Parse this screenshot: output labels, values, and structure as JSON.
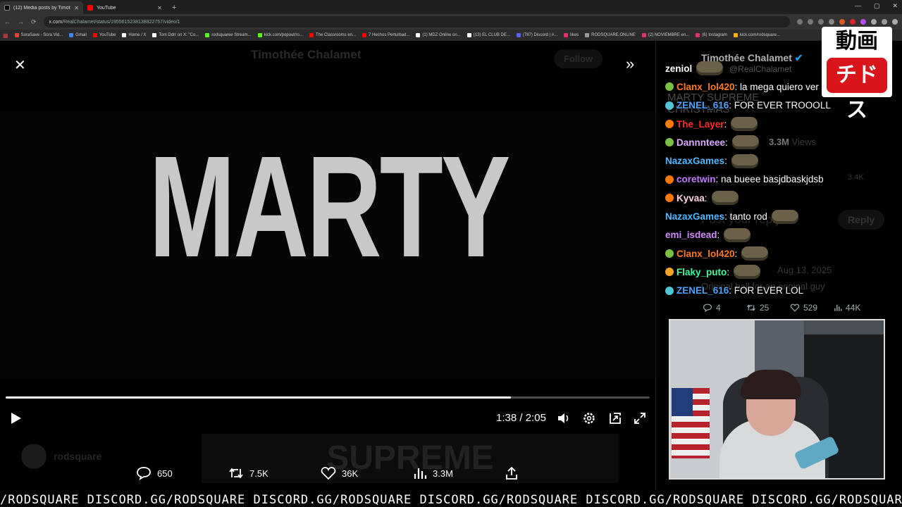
{
  "browser": {
    "tabs": [
      {
        "title": "(12) Media posts by Timoth",
        "active": true,
        "icon": "x-icon"
      },
      {
        "title": "YouTube",
        "active": false,
        "icon": "youtube-icon"
      }
    ],
    "new_tab": "+",
    "url_prefix": "x.com",
    "url_path": "/RealChalamet/status/1955615238138822757/video/1",
    "bookmarks": [
      "SoraSave - Sora Vid...",
      "Gmail",
      "YouTube",
      "Home / X",
      "Tom Ddrr on X: \"Co...",
      "rodsquaree Stream...",
      "kick.com/popout/ro...",
      "The Classrooms en...",
      "7 Hechos Perturbad...",
      "(1) MDZ Online on...",
      "(13) EL CLUB DE...",
      "(787) Discord | #...",
      "likes",
      "RODSQUARE.ONLINE",
      "(2) NOVIEMBRE en...",
      "(6) Instagram",
      "kick.com/rodsquare..."
    ]
  },
  "video": {
    "title_text": "MARTY",
    "current_time": "1:38",
    "duration": "2:05",
    "time_separator": " / ",
    "progress_fraction": 0.784,
    "ghost_header": "Timothée Chalamet",
    "ghost_follow": "Follow",
    "ghost_user": "rodsquare",
    "ghost_thumb": "SUPREME"
  },
  "actions": {
    "replies": "650",
    "reposts": "7.5K",
    "likes": "36K",
    "views": "3.3M"
  },
  "tweet_panel": {
    "author": "Timothée Chalamet",
    "handle": "@RealChalamet",
    "text_line1": "MARTY SUPREME",
    "text_line2": "CHRISTMAS",
    "views": "3.3M",
    "views_label": "Views",
    "count_small": "3.4K",
    "post_placeholder": "Post your reply",
    "reply_button": "Reply",
    "reply_date": "Aug 13, 2025",
    "reply_text": "Original ball for an original guy",
    "stats": {
      "replies": "4",
      "reposts": "25",
      "likes": "529",
      "views": "44K"
    }
  },
  "chat": [
    {
      "user": "zeniol",
      "color": "#ffffff",
      "badge": "",
      "text": "",
      "emote": true
    },
    {
      "user": "Clanx_lol420",
      "color": "#ff7a1a",
      "badge": "#7ac143",
      "text": ": la mega quiero ver",
      "emote": false
    },
    {
      "user": "ZENEL_616",
      "color": "#4fa3ff",
      "badge": "#52c4d6",
      "text": ": FOR EVER TROOOLL",
      "emote": false
    },
    {
      "user": "The_Layer",
      "color": "#ff2b2b",
      "badge": "#ff7a00",
      "text": ":",
      "emote": true
    },
    {
      "user": "Dannnteee",
      "color": "#d8a8ff",
      "badge": "#7ac143",
      "text": ":",
      "emote": true
    },
    {
      "user": "NazaxGames",
      "color": "#4fb8ff",
      "badge": "",
      "text": ":",
      "emote": true
    },
    {
      "user": "coretwin",
      "color": "#c07bff",
      "badge": "#ff7a00",
      "text": ": na bueee basjdbaskjdsb",
      "emote": false
    },
    {
      "user": "Kyvaa",
      "color": "#ffd0e6",
      "badge": "#ff7a00",
      "text": ":",
      "emote": true
    },
    {
      "user": "NazaxGames",
      "color": "#4fb8ff",
      "badge": "",
      "text": ": tanto rod",
      "emote": true
    },
    {
      "user": "emi_isdead",
      "color": "#d08cff",
      "badge": "",
      "text": ":",
      "emote": true
    },
    {
      "user": "Clanx_lol420",
      "color": "#ff7a1a",
      "badge": "#7ac143",
      "text": ":",
      "emote": true
    },
    {
      "user": "Flaky_puto",
      "color": "#3cff9a",
      "badge": "#f5a623",
      "text": ":",
      "emote": true
    },
    {
      "user": "ZENEL_616",
      "color": "#4fa3ff",
      "badge": "#52c4d6",
      "text": ": FOR EVER LOL",
      "emote": false
    }
  ],
  "logo": {
    "top": "動画",
    "bottom": "チドス"
  },
  "ticker": "/RODSQUARE DISCORD.GG/RODSQUARE DISCORD.GG/RODSQUARE DISCORD.GG/RODSQUARE DISCORD.GG/RODSQUARE DISCORD.GG/RODSQUARE DISCORD.GG",
  "colors": {
    "accent_red": "#d8151b",
    "verified_blue": "#1d9bf0",
    "youtube_red": "#ff0000"
  }
}
